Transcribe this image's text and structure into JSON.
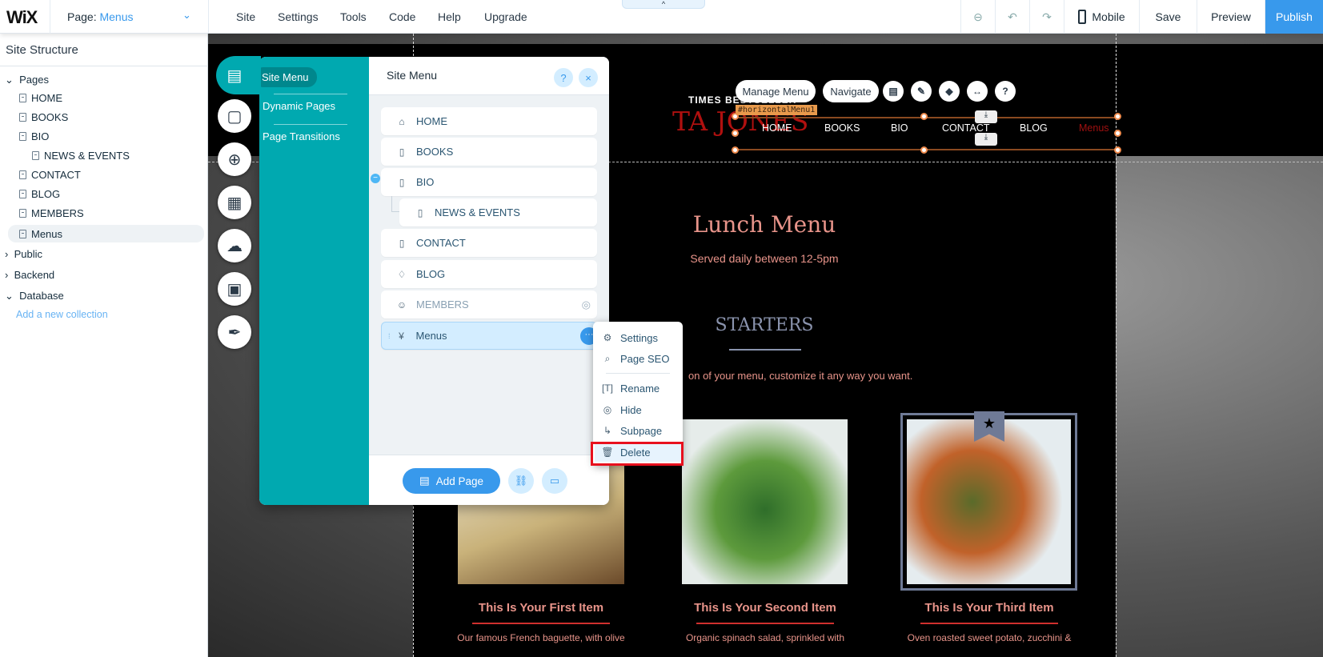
{
  "topbar": {
    "logo": "WiX",
    "page_label": "Page:",
    "page_value": "Menus",
    "menu": [
      "Site",
      "Settings",
      "Tools",
      "Code",
      "Help",
      "Upgrade"
    ],
    "mobile": "Mobile",
    "save": "Save",
    "preview": "Preview",
    "publish": "Publish",
    "collapse": "^"
  },
  "sidebar": {
    "title": "Site Structure",
    "pages_label": "Pages",
    "pages": [
      "HOME",
      "BOOKS",
      "BIO",
      "NEWS & EVENTS",
      "CONTACT",
      "BLOG",
      "MEMBERS",
      "Menus"
    ],
    "public": "Public",
    "backend": "Backend",
    "database": "Database",
    "add_collection": "Add a new collection"
  },
  "panel": {
    "tabs": [
      "Site Menu",
      "Dynamic Pages",
      "Page Transitions"
    ],
    "title": "Site Menu",
    "help": "?",
    "close": "×",
    "rows": [
      "HOME",
      "BOOKS",
      "BIO",
      "NEWS & EVENTS",
      "CONTACT",
      "BLOG",
      "MEMBERS",
      "Menus"
    ],
    "add_page": "Add Page"
  },
  "context_menu": {
    "items": [
      "Settings",
      "Page SEO",
      "Rename",
      "Hide",
      "Subpage",
      "Delete"
    ]
  },
  "site": {
    "tagline": "TIMES BESTSELLER-",
    "author": "TA JONES",
    "manage_menu": "Manage Menu",
    "navigate": "Navigate",
    "element_id": "#horizontalMenu1",
    "nav": [
      "HOME",
      "BOOKS",
      "BIO",
      "CONTACT",
      "BLOG",
      "Menus"
    ],
    "title": "Lunch Menu",
    "subtitle": "Served daily between 12-5pm",
    "section": "STARTERS",
    "section_desc": "on of your menu, customize it any way you want.",
    "items": [
      {
        "name": "This Is Your First Item",
        "desc": "Our famous French baguette, with olive"
      },
      {
        "name": "This Is Your Second Item",
        "desc": "Organic spinach salad, sprinkled with"
      },
      {
        "name": "This Is Your Third Item",
        "desc": "Oven roasted sweet potato, zucchini &"
      }
    ]
  },
  "colors": {
    "accent": "#3899ec",
    "teal": "#00a9b0",
    "site_pink": "#e8948a",
    "author_red": "#b0100f",
    "highlight": "#e8101e"
  }
}
